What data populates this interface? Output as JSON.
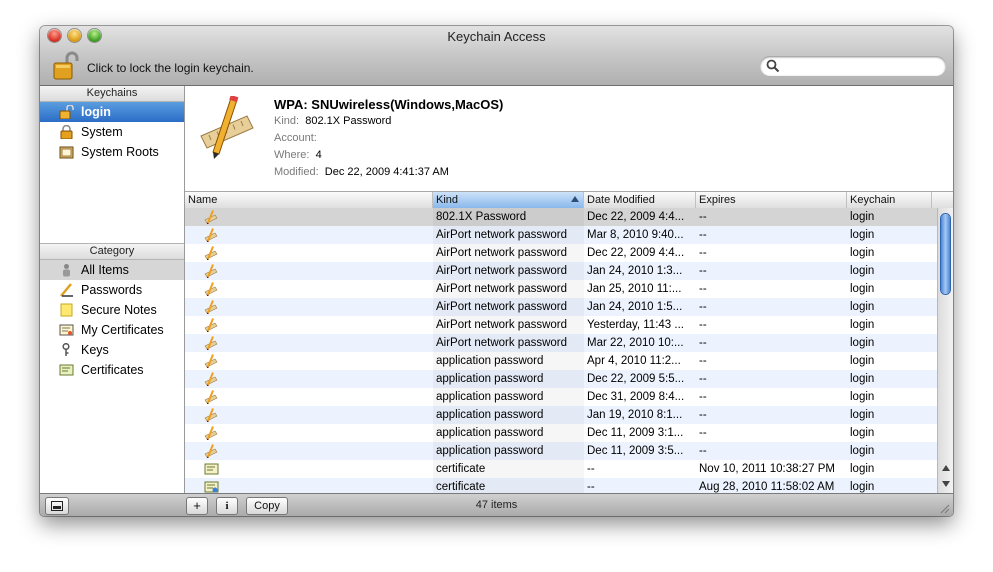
{
  "window": {
    "title": "Keychain Access"
  },
  "toolbar": {
    "lock_text": "Click to lock the login keychain.",
    "search_placeholder": ""
  },
  "sidebar": {
    "keychains_header": "Keychains",
    "keychains": [
      {
        "label": "login",
        "icon": "open-lock-icon",
        "selected": true
      },
      {
        "label": "System",
        "icon": "lock-icon",
        "selected": false
      },
      {
        "label": "System Roots",
        "icon": "certificate-folder-icon",
        "selected": false
      }
    ],
    "category_header": "Category",
    "categories": [
      {
        "label": "All Items",
        "icon": "people-icon",
        "selected": true
      },
      {
        "label": "Passwords",
        "icon": "pencil-ruler-icon",
        "selected": false
      },
      {
        "label": "Secure Notes",
        "icon": "note-icon",
        "selected": false
      },
      {
        "label": "My Certificates",
        "icon": "my-certificate-icon",
        "selected": false
      },
      {
        "label": "Keys",
        "icon": "key-icon",
        "selected": false
      },
      {
        "label": "Certificates",
        "icon": "certificate-icon",
        "selected": false
      }
    ]
  },
  "detail": {
    "name": "WPA: SNUwireless(Windows,MacOS)",
    "kind_label": "Kind:",
    "kind": "802.1X Password",
    "account_label": "Account:",
    "account": "",
    "where_label": "Where:",
    "where": "4",
    "modified_label": "Modified:",
    "modified": "Dec 22, 2009 4:41:37 AM"
  },
  "table": {
    "columns": [
      "Name",
      "Kind",
      "Date Modified",
      "Expires",
      "Keychain"
    ],
    "sorted_column": "Kind",
    "rows": [
      {
        "icon": "password-icon",
        "kind": "802.1X Password",
        "date": "Dec 22, 2009 4:4...",
        "expires": "--",
        "keychain": "login"
      },
      {
        "icon": "password-icon",
        "kind": "AirPort network password",
        "date": "Mar 8, 2010 9:40...",
        "expires": "--",
        "keychain": "login"
      },
      {
        "icon": "password-icon",
        "kind": "AirPort network password",
        "date": "Dec 22, 2009 4:4...",
        "expires": "--",
        "keychain": "login"
      },
      {
        "icon": "password-icon",
        "kind": "AirPort network password",
        "date": "Jan 24, 2010 1:3...",
        "expires": "--",
        "keychain": "login"
      },
      {
        "icon": "password-icon",
        "kind": "AirPort network password",
        "date": "Jan 25, 2010 11:...",
        "expires": "--",
        "keychain": "login"
      },
      {
        "icon": "password-icon",
        "kind": "AirPort network password",
        "date": "Jan 24, 2010 1:5...",
        "expires": "--",
        "keychain": "login"
      },
      {
        "icon": "password-icon",
        "kind": "AirPort network password",
        "date": "Yesterday, 11:43 ...",
        "expires": "--",
        "keychain": "login"
      },
      {
        "icon": "password-icon",
        "kind": "AirPort network password",
        "date": "Mar 22, 2010 10:...",
        "expires": "--",
        "keychain": "login"
      },
      {
        "icon": "password-icon",
        "kind": "application password",
        "date": "Apr 4, 2010 11:2...",
        "expires": "--",
        "keychain": "login"
      },
      {
        "icon": "password-icon",
        "kind": "application password",
        "date": "Dec 22, 2009 5:5...",
        "expires": "--",
        "keychain": "login"
      },
      {
        "icon": "password-icon",
        "kind": "application password",
        "date": "Dec 31, 2009 8:4...",
        "expires": "--",
        "keychain": "login"
      },
      {
        "icon": "password-icon",
        "kind": "application password",
        "date": "Jan 19, 2010 8:1...",
        "expires": "--",
        "keychain": "login"
      },
      {
        "icon": "password-icon",
        "kind": "application password",
        "date": "Dec 11, 2009 3:1...",
        "expires": "--",
        "keychain": "login"
      },
      {
        "icon": "password-icon",
        "kind": "application password",
        "date": "Dec 11, 2009 3:5...",
        "expires": "--",
        "keychain": "login"
      },
      {
        "icon": "certificate-icon",
        "kind": "certificate",
        "date": "--",
        "expires": "Nov 10, 2011 10:38:27 PM",
        "keychain": "login"
      },
      {
        "icon": "certificate-icon",
        "kind": "certificate",
        "date": "--",
        "expires": "Aug 28, 2010 11:58:02 AM",
        "keychain": "login"
      }
    ]
  },
  "bottombar": {
    "add_label": "+",
    "info_label": "i",
    "copy_label": "Copy",
    "status": "47 items"
  },
  "colors": {
    "selection": "#2a6dc6",
    "alt_row": "#edf3fe",
    "selected_row": "#d4d4d4"
  }
}
